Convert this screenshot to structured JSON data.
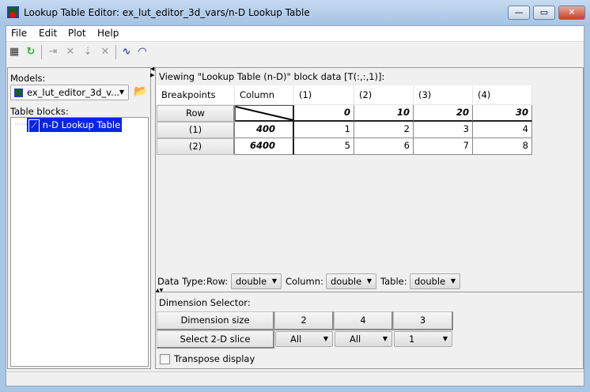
{
  "window": {
    "title": "Lookup Table Editor: ex_lut_editor_3d_vars/n-D Lookup Table",
    "minimize": "—",
    "maximize": "▭",
    "close": "✕"
  },
  "menu": [
    "File",
    "Edit",
    "Plot",
    "Help"
  ],
  "toolbar": {
    "icons": [
      "table-icon",
      "refresh-icon",
      "add-row-icon",
      "delete-row-icon",
      "add-column-icon",
      "delete-column-icon",
      "line-plot-icon",
      "mesh-plot-icon"
    ]
  },
  "left": {
    "models_label": "Models:",
    "model_value": "ex_lut_editor_3d_v...",
    "table_blocks_label": "Table blocks:",
    "tree_item": "n-D Lookup Table"
  },
  "right": {
    "viewing": "Viewing \"Lookup Table (n-D)\" block data [T(:,:,1)]:",
    "headers": [
      "Breakpoints",
      "Column",
      "(1)",
      "(2)",
      "(3)",
      "(4)"
    ],
    "row_label": "Row",
    "col_breakpoints": [
      "0",
      "10",
      "20",
      "30"
    ],
    "rows": [
      {
        "label": "(1)",
        "bp": "400",
        "values": [
          "1",
          "2",
          "3",
          "4"
        ]
      },
      {
        "label": "(2)",
        "bp": "6400",
        "values": [
          "5",
          "6",
          "7",
          "8"
        ]
      }
    ],
    "datatype_label": "Data Type:",
    "row_type_label": "Row:",
    "row_type": "double",
    "col_type_label": "Column:",
    "col_type": "double",
    "table_type_label": "Table:",
    "table_type": "double",
    "dim_selector_label": "Dimension Selector:",
    "dim_size_label": "Dimension size",
    "dim_sizes": [
      "2",
      "4",
      "3"
    ],
    "slice_label": "Select 2-D slice",
    "slices": [
      "All",
      "All",
      "1"
    ],
    "transpose_label": "Transpose display"
  }
}
